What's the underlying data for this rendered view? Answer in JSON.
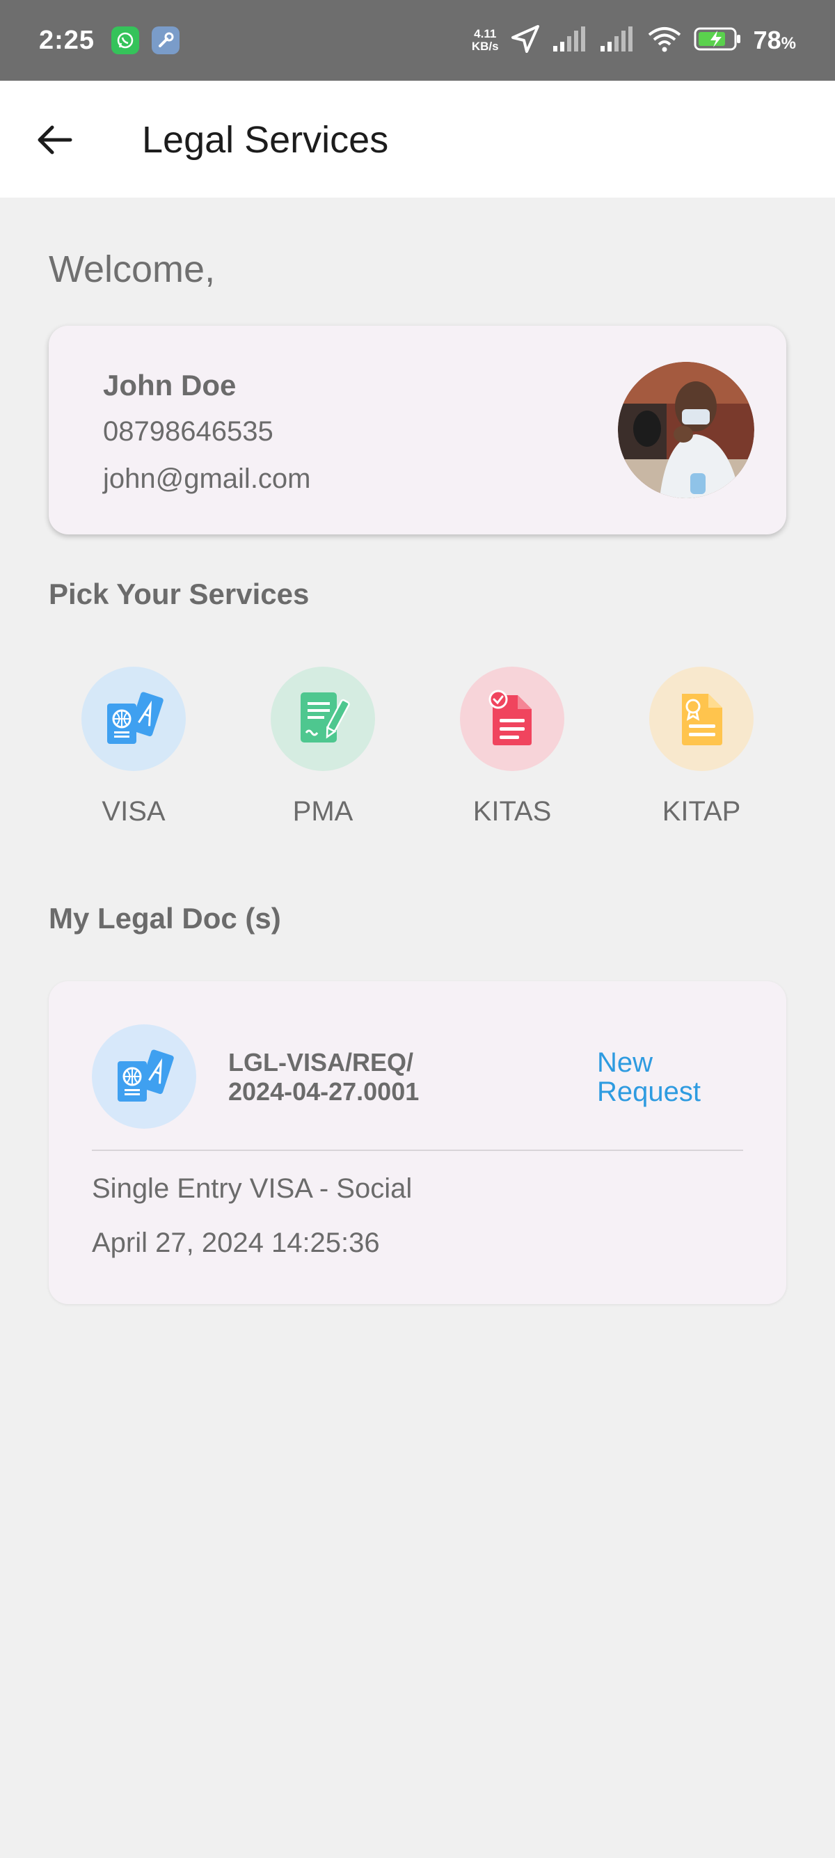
{
  "status_bar": {
    "time": "2:25",
    "net_speed_value": "4.11",
    "net_speed_unit": "KB/s",
    "battery_percent": "78",
    "battery_symbol": "%"
  },
  "app_bar": {
    "title": "Legal Services"
  },
  "welcome": "Welcome,",
  "profile": {
    "name": "John Doe",
    "phone": "08798646535",
    "email": "john@gmail.com"
  },
  "services_section": {
    "title": "Pick Your Services",
    "items": [
      {
        "label": "VISA",
        "icon": "passport-icon",
        "bg": "#d6e8f8",
        "color": "#3fa0f0"
      },
      {
        "label": "PMA",
        "icon": "contract-icon",
        "bg": "#d5ece1",
        "color": "#4ec78f"
      },
      {
        "label": "KITAS",
        "icon": "document-check-icon",
        "bg": "#f7d4d9",
        "color": "#f0445e"
      },
      {
        "label": "KITAP",
        "icon": "certificate-icon",
        "bg": "#f8e8cd",
        "color": "#ffc44d"
      }
    ]
  },
  "docs_section": {
    "title": "My Legal Doc (s)",
    "items": [
      {
        "id_line1": "LGL-VISA/REQ/",
        "id_line2": "2024-04-27.0001",
        "status_line1": "New",
        "status_line2": "Request",
        "type": "Single Entry VISA - Social",
        "date": "April 27, 2024 14:25:36",
        "icon": "passport-icon"
      }
    ]
  },
  "colors": {
    "status_bar_bg": "#6e6e6e",
    "page_bg": "#f0f0f0",
    "card_bg": "#f6f1f6",
    "accent_blue": "#2e9be0",
    "text_gray": "#6b6b6b"
  }
}
